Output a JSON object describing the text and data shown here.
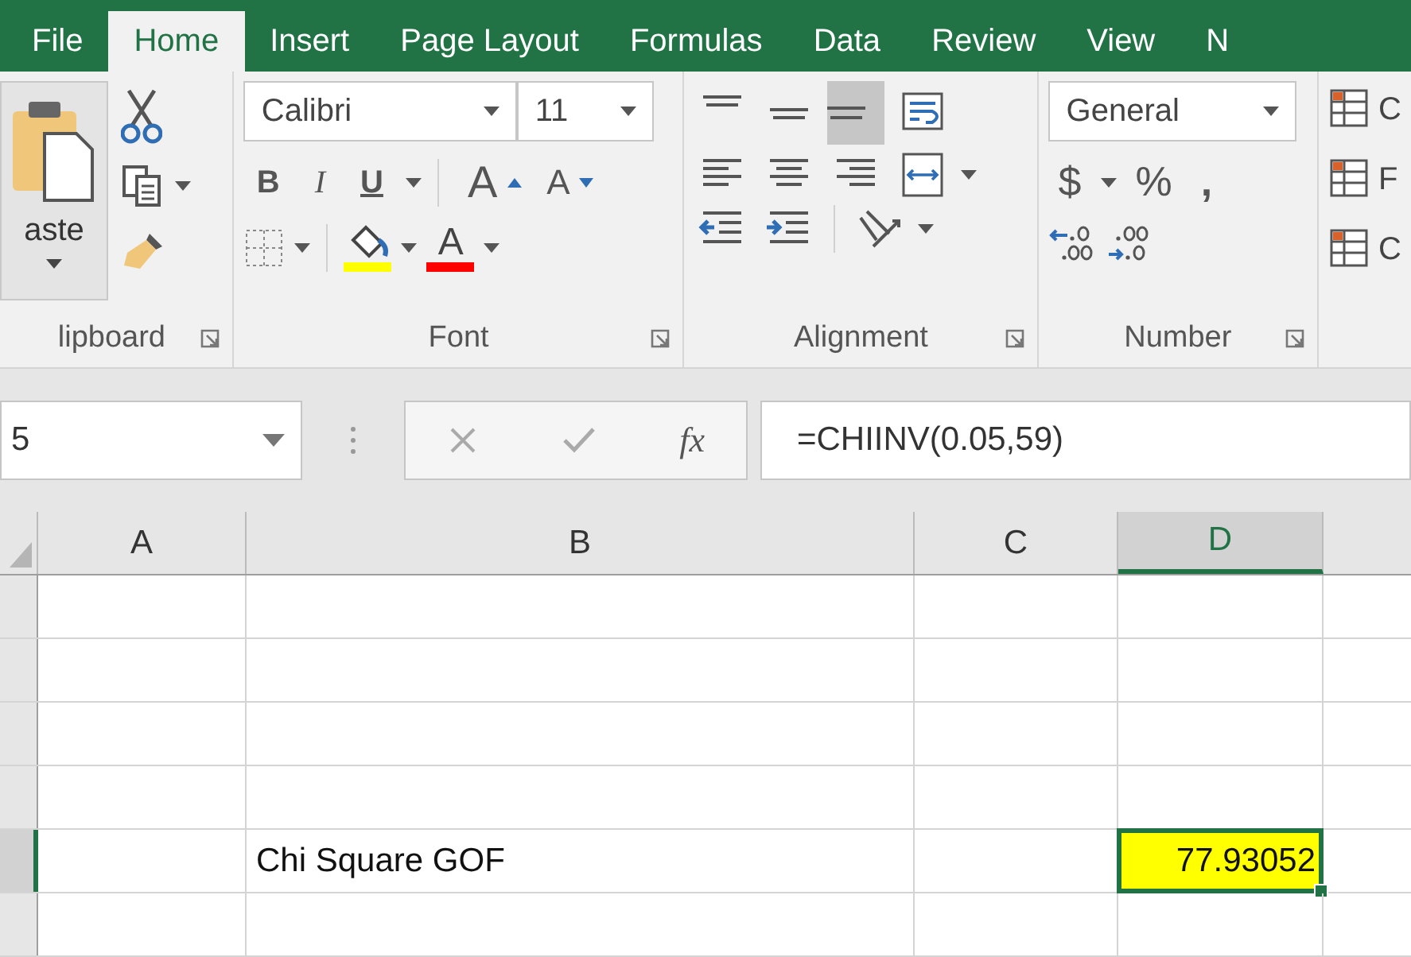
{
  "tabs": [
    {
      "label": "File",
      "selected": false
    },
    {
      "label": "Home",
      "selected": true
    },
    {
      "label": "Insert",
      "selected": false
    },
    {
      "label": "Page Layout",
      "selected": false
    },
    {
      "label": "Formulas",
      "selected": false
    },
    {
      "label": "Data",
      "selected": false
    },
    {
      "label": "Review",
      "selected": false
    },
    {
      "label": "View",
      "selected": false
    },
    {
      "label": "N",
      "selected": false
    }
  ],
  "ribbon": {
    "clipboard": {
      "paste_label": "aste",
      "group_label": "lipboard"
    },
    "font": {
      "name": "Calibri",
      "size": "11",
      "bold": "B",
      "italic": "I",
      "underline": "U",
      "grow": "A",
      "shrink": "A",
      "font_color": "A",
      "group_label": "Font"
    },
    "alignment": {
      "bottom_align_selected": true,
      "group_label": "Alignment"
    },
    "number": {
      "format": "General",
      "currency": "$",
      "percent": "%",
      "comma": ",",
      "group_label": "Number"
    },
    "styles": {
      "labels": [
        "C",
        "F",
        "C"
      ]
    }
  },
  "formula_bar": {
    "name_box": "5",
    "function_label": "fx",
    "formula": "=CHIINV(0.05,59)"
  },
  "sheet": {
    "columns": [
      {
        "label": "A",
        "selected": false
      },
      {
        "label": "B",
        "selected": false
      },
      {
        "label": "C",
        "selected": false
      },
      {
        "label": "D",
        "selected": true
      }
    ],
    "rows": [
      {
        "selected": false,
        "cells": []
      },
      {
        "selected": false,
        "cells": []
      },
      {
        "selected": false,
        "cells": []
      },
      {
        "selected": false,
        "cells": []
      },
      {
        "selected": true,
        "highlighted": true,
        "cells": [
          "",
          "Chi Square GOF",
          "",
          "77.93052"
        ]
      },
      {
        "selected": false,
        "cells": []
      }
    ]
  }
}
